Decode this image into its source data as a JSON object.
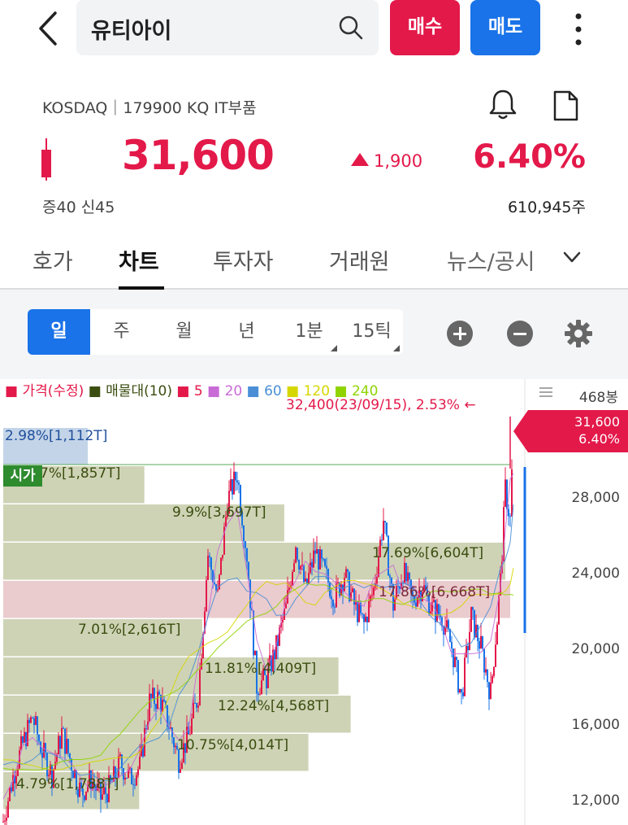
{
  "header": {
    "search_text": "유티아이",
    "buy_label": "매수",
    "sell_label": "매도"
  },
  "stock": {
    "market_line": "KOSDAQ｜179900 KQ IT부품",
    "price": "31,600",
    "change": "1,900",
    "change_pct": "6.40%",
    "margin": "증40  신45",
    "volume": "610,945주"
  },
  "tabs": [
    {
      "label": "호가"
    },
    {
      "label": "차트"
    },
    {
      "label": "투자자"
    },
    {
      "label": "거래원"
    },
    {
      "label": "뉴스/공시"
    }
  ],
  "periods": [
    {
      "label": "일"
    },
    {
      "label": "주"
    },
    {
      "label": "월"
    },
    {
      "label": "년"
    },
    {
      "label": "1분"
    },
    {
      "label": "15틱"
    }
  ],
  "legend": {
    "price": "가격(수정)",
    "vp": "매물대(10)",
    "ma5": "5",
    "ma20": "20",
    "ma60": "60",
    "ma120": "120",
    "ma240": "240"
  },
  "chart": {
    "axis_unit": "468봉",
    "max_label": "32,400(23/09/15), 2.53% ←",
    "current_price": "31,600",
    "current_pct": "6.40%",
    "open_label": "시가",
    "y_ticks": [
      "28,000",
      "24,000",
      "20,000",
      "16,000",
      "12,000"
    ]
  },
  "colors": {
    "up": "#e3194a",
    "down": "#1a73e8",
    "vp_bar": "#c5cba8",
    "vp_bar_current": "#e6c2c6",
    "vp_bar_top": "#b9cce4"
  },
  "chart_data": {
    "type": "volume-profile",
    "y_unit": "price",
    "ylim": [
      11000,
      33000
    ],
    "volume_profile": [
      {
        "pct": 2.98,
        "label": "2.98%[1,112T]"
      },
      {
        "pct": 4.97,
        "label": "4.97%[1,857T]"
      },
      {
        "pct": 9.9,
        "label": "9.9%[3,697T]"
      },
      {
        "pct": 17.69,
        "label": "17.69%[6,604T]"
      },
      {
        "pct": 17.86,
        "label": "17.86%[6,668T]"
      },
      {
        "pct": 7.01,
        "label": "7.01%[2,616T]"
      },
      {
        "pct": 11.81,
        "label": "11.81%[4,409T]"
      },
      {
        "pct": 12.24,
        "label": "12.24%[4,568T]"
      },
      {
        "pct": 10.75,
        "label": "10.75%[4,014T]"
      },
      {
        "pct": 4.79,
        "label": "4.79%[1,788T]"
      }
    ],
    "price_path": [
      [
        0,
        11200
      ],
      [
        12,
        13500
      ],
      [
        24,
        15200
      ],
      [
        36,
        16600
      ],
      [
        48,
        14800
      ],
      [
        60,
        13600
      ],
      [
        72,
        15800
      ],
      [
        84,
        14200
      ],
      [
        96,
        12600
      ],
      [
        108,
        13400
      ],
      [
        120,
        12400
      ],
      [
        132,
        13000
      ],
      [
        144,
        14200
      ],
      [
        156,
        13400
      ],
      [
        168,
        14000
      ],
      [
        180,
        17400
      ],
      [
        192,
        17600
      ],
      [
        204,
        16200
      ],
      [
        216,
        14400
      ],
      [
        228,
        15600
      ],
      [
        240,
        17800
      ],
      [
        252,
        25000
      ],
      [
        264,
        22800
      ],
      [
        276,
        27800
      ],
      [
        288,
        29200
      ],
      [
        300,
        25000
      ],
      [
        312,
        18200
      ],
      [
        324,
        18600
      ],
      [
        336,
        20200
      ],
      [
        348,
        22200
      ],
      [
        360,
        25600
      ],
      [
        372,
        23200
      ],
      [
        384,
        25200
      ],
      [
        396,
        24000
      ],
      [
        408,
        22800
      ],
      [
        420,
        24000
      ],
      [
        432,
        22400
      ],
      [
        444,
        21400
      ],
      [
        456,
        23200
      ],
      [
        468,
        26800
      ],
      [
        480,
        22400
      ],
      [
        492,
        24200
      ],
      [
        504,
        22600
      ],
      [
        516,
        23400
      ],
      [
        528,
        22200
      ],
      [
        540,
        21800
      ],
      [
        552,
        20200
      ],
      [
        564,
        17600
      ],
      [
        576,
        21800
      ],
      [
        588,
        20200
      ],
      [
        600,
        17800
      ],
      [
        612,
        23600
      ],
      [
        618,
        28400
      ],
      [
        624,
        26800
      ],
      [
        628,
        31600
      ]
    ]
  }
}
